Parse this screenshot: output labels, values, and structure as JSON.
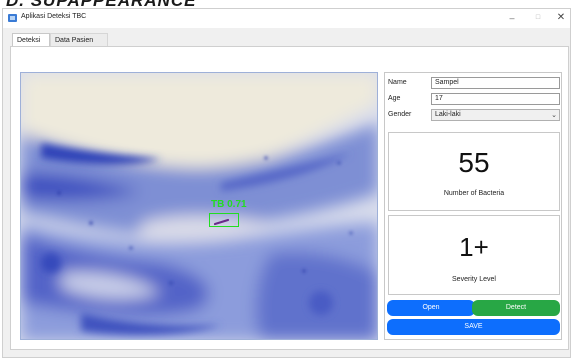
{
  "document": {
    "heading": "D.   SUPAPPEARANCE"
  },
  "window": {
    "title": "Aplikasi Deteksi TBC",
    "controls": {
      "minimize": "–",
      "maximize": "□",
      "close": "✕"
    }
  },
  "tabs": [
    {
      "label": "Deteksi",
      "active": true
    },
    {
      "label": "Data Pasien",
      "active": false
    }
  ],
  "detection": {
    "label": "TB  0.71"
  },
  "form": {
    "name": {
      "label": "Name",
      "value": "Sampel"
    },
    "age": {
      "label": "Age",
      "value": "17"
    },
    "gender": {
      "label": "Gender",
      "value": "Laki-laki"
    }
  },
  "stats": {
    "bacteria": {
      "value": "55",
      "caption": "Number of Bacteria"
    },
    "severity": {
      "value": "1+",
      "caption": "Severity Level"
    }
  },
  "buttons": {
    "open": "Open",
    "detect": "Detect",
    "save": "SAVE"
  },
  "colors": {
    "primary": "#0d6efd",
    "success": "#28a745",
    "detection": "#22dd22",
    "stain": "#4a5cc4"
  }
}
